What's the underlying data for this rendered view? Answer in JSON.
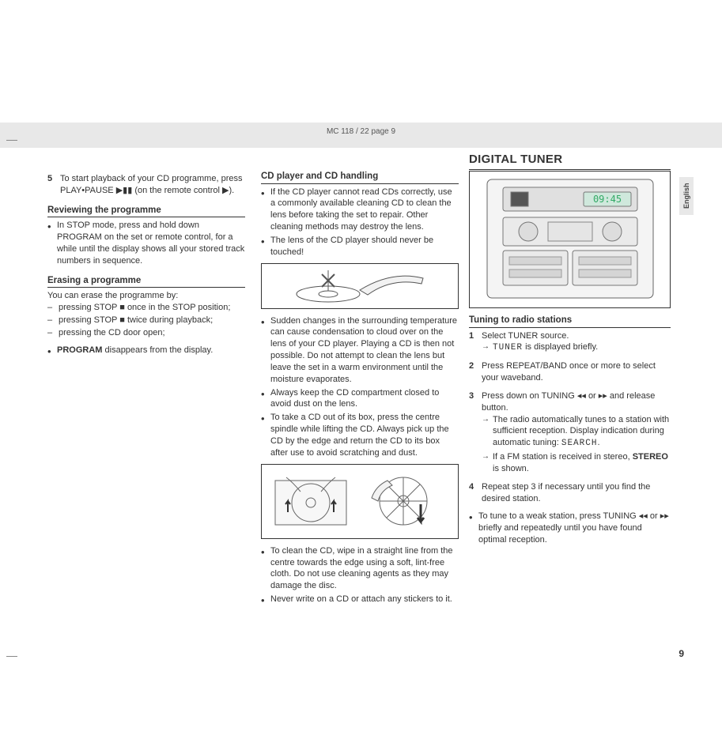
{
  "header": {
    "breadcrumb": "MC 118 / 22  page 9"
  },
  "page_number": "9",
  "side_tab": "English",
  "main_title": "DIGITAL TUNER",
  "col1": {
    "step5_num": "5",
    "step5_text": "To start playback of your CD programme, press PLAY•PAUSE ▶▮▮ (on the remote control ▶).",
    "review_h": "Reviewing the programme",
    "review_b1": "In STOP mode, press and hold down PROGRAM on the set or remote control, for a while until the display shows all your stored track numbers in sequence.",
    "erase_h": "Erasing a programme",
    "erase_intro": "You can erase the programme by:",
    "erase_d1": "pressing STOP ■ once in the STOP position;",
    "erase_d2": "pressing STOP ■ twice during playback;",
    "erase_d3": "pressing the CD door open;",
    "erase_note_pre": "PROGRAM",
    "erase_note_post": "  disappears from the display."
  },
  "col2": {
    "cd_h": "CD player and CD handling",
    "cd_b1": "If the CD player cannot read CDs correctly, use a commonly available cleaning CD to clean the lens before taking the set to repair. Other cleaning methods may destroy the lens.",
    "cd_b2": "The lens of the CD player should never be touched!",
    "cd_b3": "Sudden changes in the surrounding temperature can cause condensation to cloud over on the lens of your CD player. Playing a CD is then not possible. Do not attempt to clean the lens but leave the set in a warm environment until the moisture evaporates.",
    "cd_b4": "Always keep the CD compartment closed to avoid dust on the lens.",
    "cd_b5": "To take a CD out of its box, press the centre spindle while lifting the CD. Always pick up the CD by the edge and return the CD to its box after use to avoid scratching and dust.",
    "cd_b6": "To clean the CD, wipe in a straight line from the centre towards the edge using a soft, lint-free cloth. Do not use cleaning agents as they may damage the disc.",
    "cd_b7": "Never write on a CD or attach any stickers to it."
  },
  "col3": {
    "tune_h": "Tuning to radio stations",
    "s1_num": "1",
    "s1_text": "Select TUNER source.",
    "s1_a1_pre": "TUNER",
    "s1_a1_post": " is displayed briefly.",
    "s2_num": "2",
    "s2_text_pre": "Press REPEAT/",
    "s2_text_mid": "BAND",
    "s2_text_post": " once or more to select your waveband.",
    "s3_num": "3",
    "s3_text": "Press down on TUNING ◂◂ or ▸▸ and release button.",
    "s3_a1_pre": "The radio automatically tunes to a station with sufficient reception. Display indication during automatic tuning: ",
    "s3_a1_lcd": "SEARCH",
    "s3_a1_post": ".",
    "s3_a2_pre": "If a FM station is received in stereo, ",
    "s3_a2_bold": "STEREO",
    "s3_a2_post": " is shown.",
    "s4_num": "4",
    "s4_text": "Repeat step 3 if necessary until you find the desired station.",
    "weak_b": "To tune to a weak station, press TUNING ◂◂ or ▸▸ briefly and repeatedly until you have found optimal reception."
  }
}
